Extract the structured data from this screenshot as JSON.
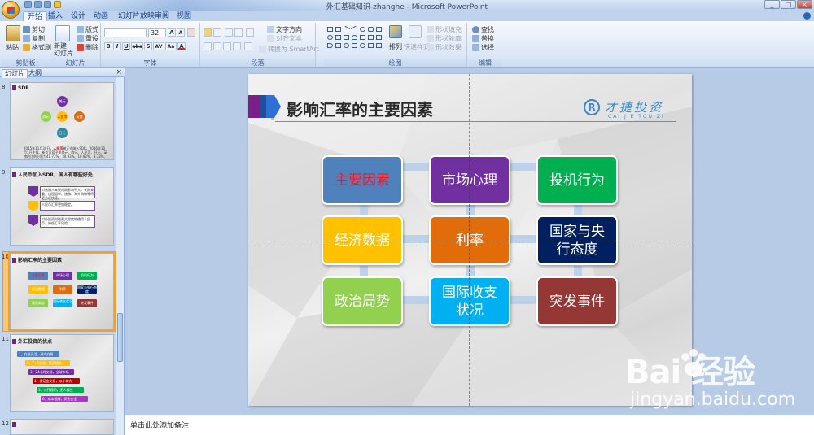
{
  "window": {
    "title": "外汇基础知识-zhanghe - Microsoft PowerPoint",
    "controls": [
      "_",
      "□",
      "×"
    ]
  },
  "ribbon_tabs": [
    "开始",
    "插入",
    "设计",
    "动画",
    "幻灯片放映",
    "审阅",
    "视图"
  ],
  "ribbon": {
    "clipboard": {
      "paste": "粘贴",
      "cut": "剪切",
      "copy": "复制",
      "format_painter": "格式刷",
      "label": "剪贴板"
    },
    "slides": {
      "new_slide": "新建\n幻灯片",
      "layout": "版式",
      "reset": "重设",
      "delete": "删除",
      "label": "幻灯片"
    },
    "font": {
      "font_name": "",
      "font_size": "32",
      "bold": "B",
      "italic": "I",
      "underline": "U",
      "strike": "abc",
      "shadow": "S",
      "spacing": "AV",
      "case": "Aa",
      "color": "A",
      "grow": "A",
      "shrink": "A",
      "label": "字体"
    },
    "paragraph": {
      "text_direction": "文字方向",
      "align_text": "对齐文本",
      "convert_smartart": "转换为 SmartArt",
      "label": "段落"
    },
    "drawing": {
      "arrange": "排列",
      "quick_styles": "快速样式",
      "shape_fill": "形状填充",
      "shape_outline": "形状轮廓",
      "shape_effects": "形状效果",
      "label": "绘图"
    },
    "editing": {
      "find": "查找",
      "replace": "替换",
      "select": "选择",
      "label": "编辑"
    }
  },
  "pane_tabs": [
    "幻灯片",
    "大纲"
  ],
  "thumbnails": [
    {
      "num": "8",
      "title": "SDR",
      "circles": [
        "美元",
        "欧元",
        "英镑",
        "日元",
        "人民币"
      ],
      "caption_black": "2015年11月30日，",
      "caption_red": "人民币",
      "caption_tail": "被正式纳入SDR，2016年10月1日生效。新货币篮子里美元、欧元、人民币、日元、英镑的比例分别为41.73%、30.93%、10.92%、8.33%、8.09%。"
    },
    {
      "num": "9",
      "title": "人民币加入SDR，国人有哪些好处",
      "bullets": [
        "对普通人来说短期影响不大，长期来看，出国留学、旅游、海外购物等将更方便快捷。",
        "人民币汇率更加稳定。",
        "对外投资时能更大程度地使用人民币，降低汇率风险。"
      ]
    },
    {
      "num": "10",
      "title": "影响汇率的主要因素",
      "boxes": [
        "主要因素",
        "市场心理",
        "投机行为",
        "经济数据",
        "利率",
        "国家与央行态度",
        "政治局势",
        "国际收支状况",
        "突发事件"
      ]
    },
    {
      "num": "11",
      "title": "外汇投资的优点",
      "bars": [
        "1、交易灵活，双向交易",
        "2、T+0交易，随买随卖",
        "3、24小时交易，全球市场",
        "4、保证金交易，以小博大",
        "5、公开透明，无人操控",
        "6、成本低廉，资金安全"
      ]
    },
    {
      "num": "12",
      "title": ""
    }
  ],
  "slide": {
    "title": "影响汇率的主要因素",
    "logo_cn": "才捷投资",
    "logo_en": "CAI JIE TOU ZI",
    "logo_letter": "R",
    "factors": [
      {
        "label": "主要因素",
        "color": "#4f81bd",
        "text_color": "#e8192c"
      },
      {
        "label": "市场心理",
        "color": "#7030a0",
        "text_color": "#ffffff"
      },
      {
        "label": "投机行为",
        "color": "#00b050",
        "text_color": "#ffffff"
      },
      {
        "label": "经济数据",
        "color": "#ffc000",
        "text_color": "#ffffff"
      },
      {
        "label": "利率",
        "color": "#e36c0a",
        "text_color": "#ffffff"
      },
      {
        "label": "国家与央行态度",
        "color": "#002060",
        "text_color": "#ffffff"
      },
      {
        "label": "政治局势",
        "color": "#92d050",
        "text_color": "#ffffff"
      },
      {
        "label": "国际收支状况",
        "color": "#00b0f0",
        "text_color": "#ffffff"
      },
      {
        "label": "突发事件",
        "color": "#953735",
        "text_color": "#ffffff"
      }
    ]
  },
  "notes": {
    "placeholder": "单击此处添加备注"
  },
  "watermark": {
    "logo": "Bai 经验",
    "url": "jingyan.baidu.com"
  }
}
